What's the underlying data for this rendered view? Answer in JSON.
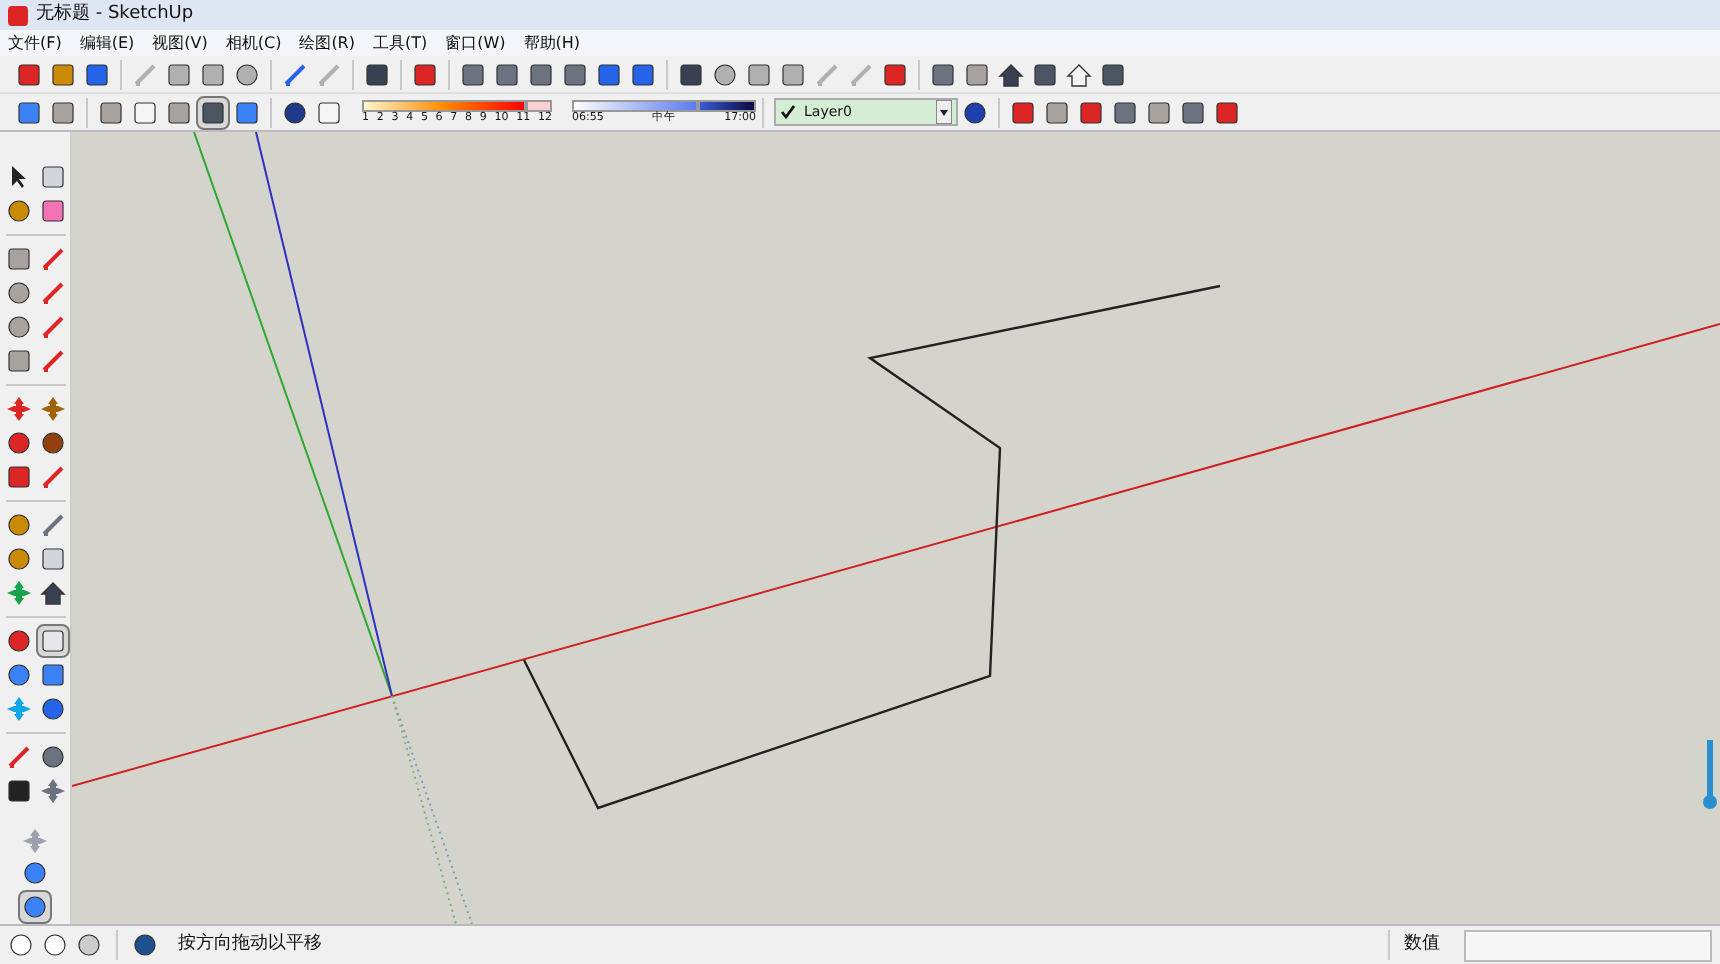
{
  "window": {
    "title": "无标题 - SketchUp"
  },
  "menu": [
    "文件(F)",
    "编辑(E)",
    "视图(V)",
    "相机(C)",
    "绘图(R)",
    "工具(T)",
    "窗口(W)",
    "帮助(H)"
  ],
  "style_toolbar": [
    {
      "selected": false
    },
    {
      "selected": false
    },
    {
      "selected": false
    },
    {
      "selected": true
    },
    {
      "selected": false
    }
  ],
  "shadow": {
    "month_slider": {
      "level": 0.86
    },
    "time_slider": {
      "level": 0.68
    },
    "months": [
      "1",
      "2",
      "3",
      "4",
      "5",
      "6",
      "7",
      "8",
      "9",
      "10",
      "11",
      "12"
    ],
    "time_start": "06:55",
    "time_noon": "中午",
    "time_end": "17:00"
  },
  "layer": {
    "name": "Layer0",
    "checked": true
  },
  "left_toolbar": {
    "pan_selected": true,
    "bottom_tools": [
      {
        "selected": false
      },
      {
        "selected": false
      },
      {
        "selected": true
      }
    ]
  },
  "status_bar": {
    "hint": "按方向拖动以平移",
    "value_label": "数值"
  }
}
